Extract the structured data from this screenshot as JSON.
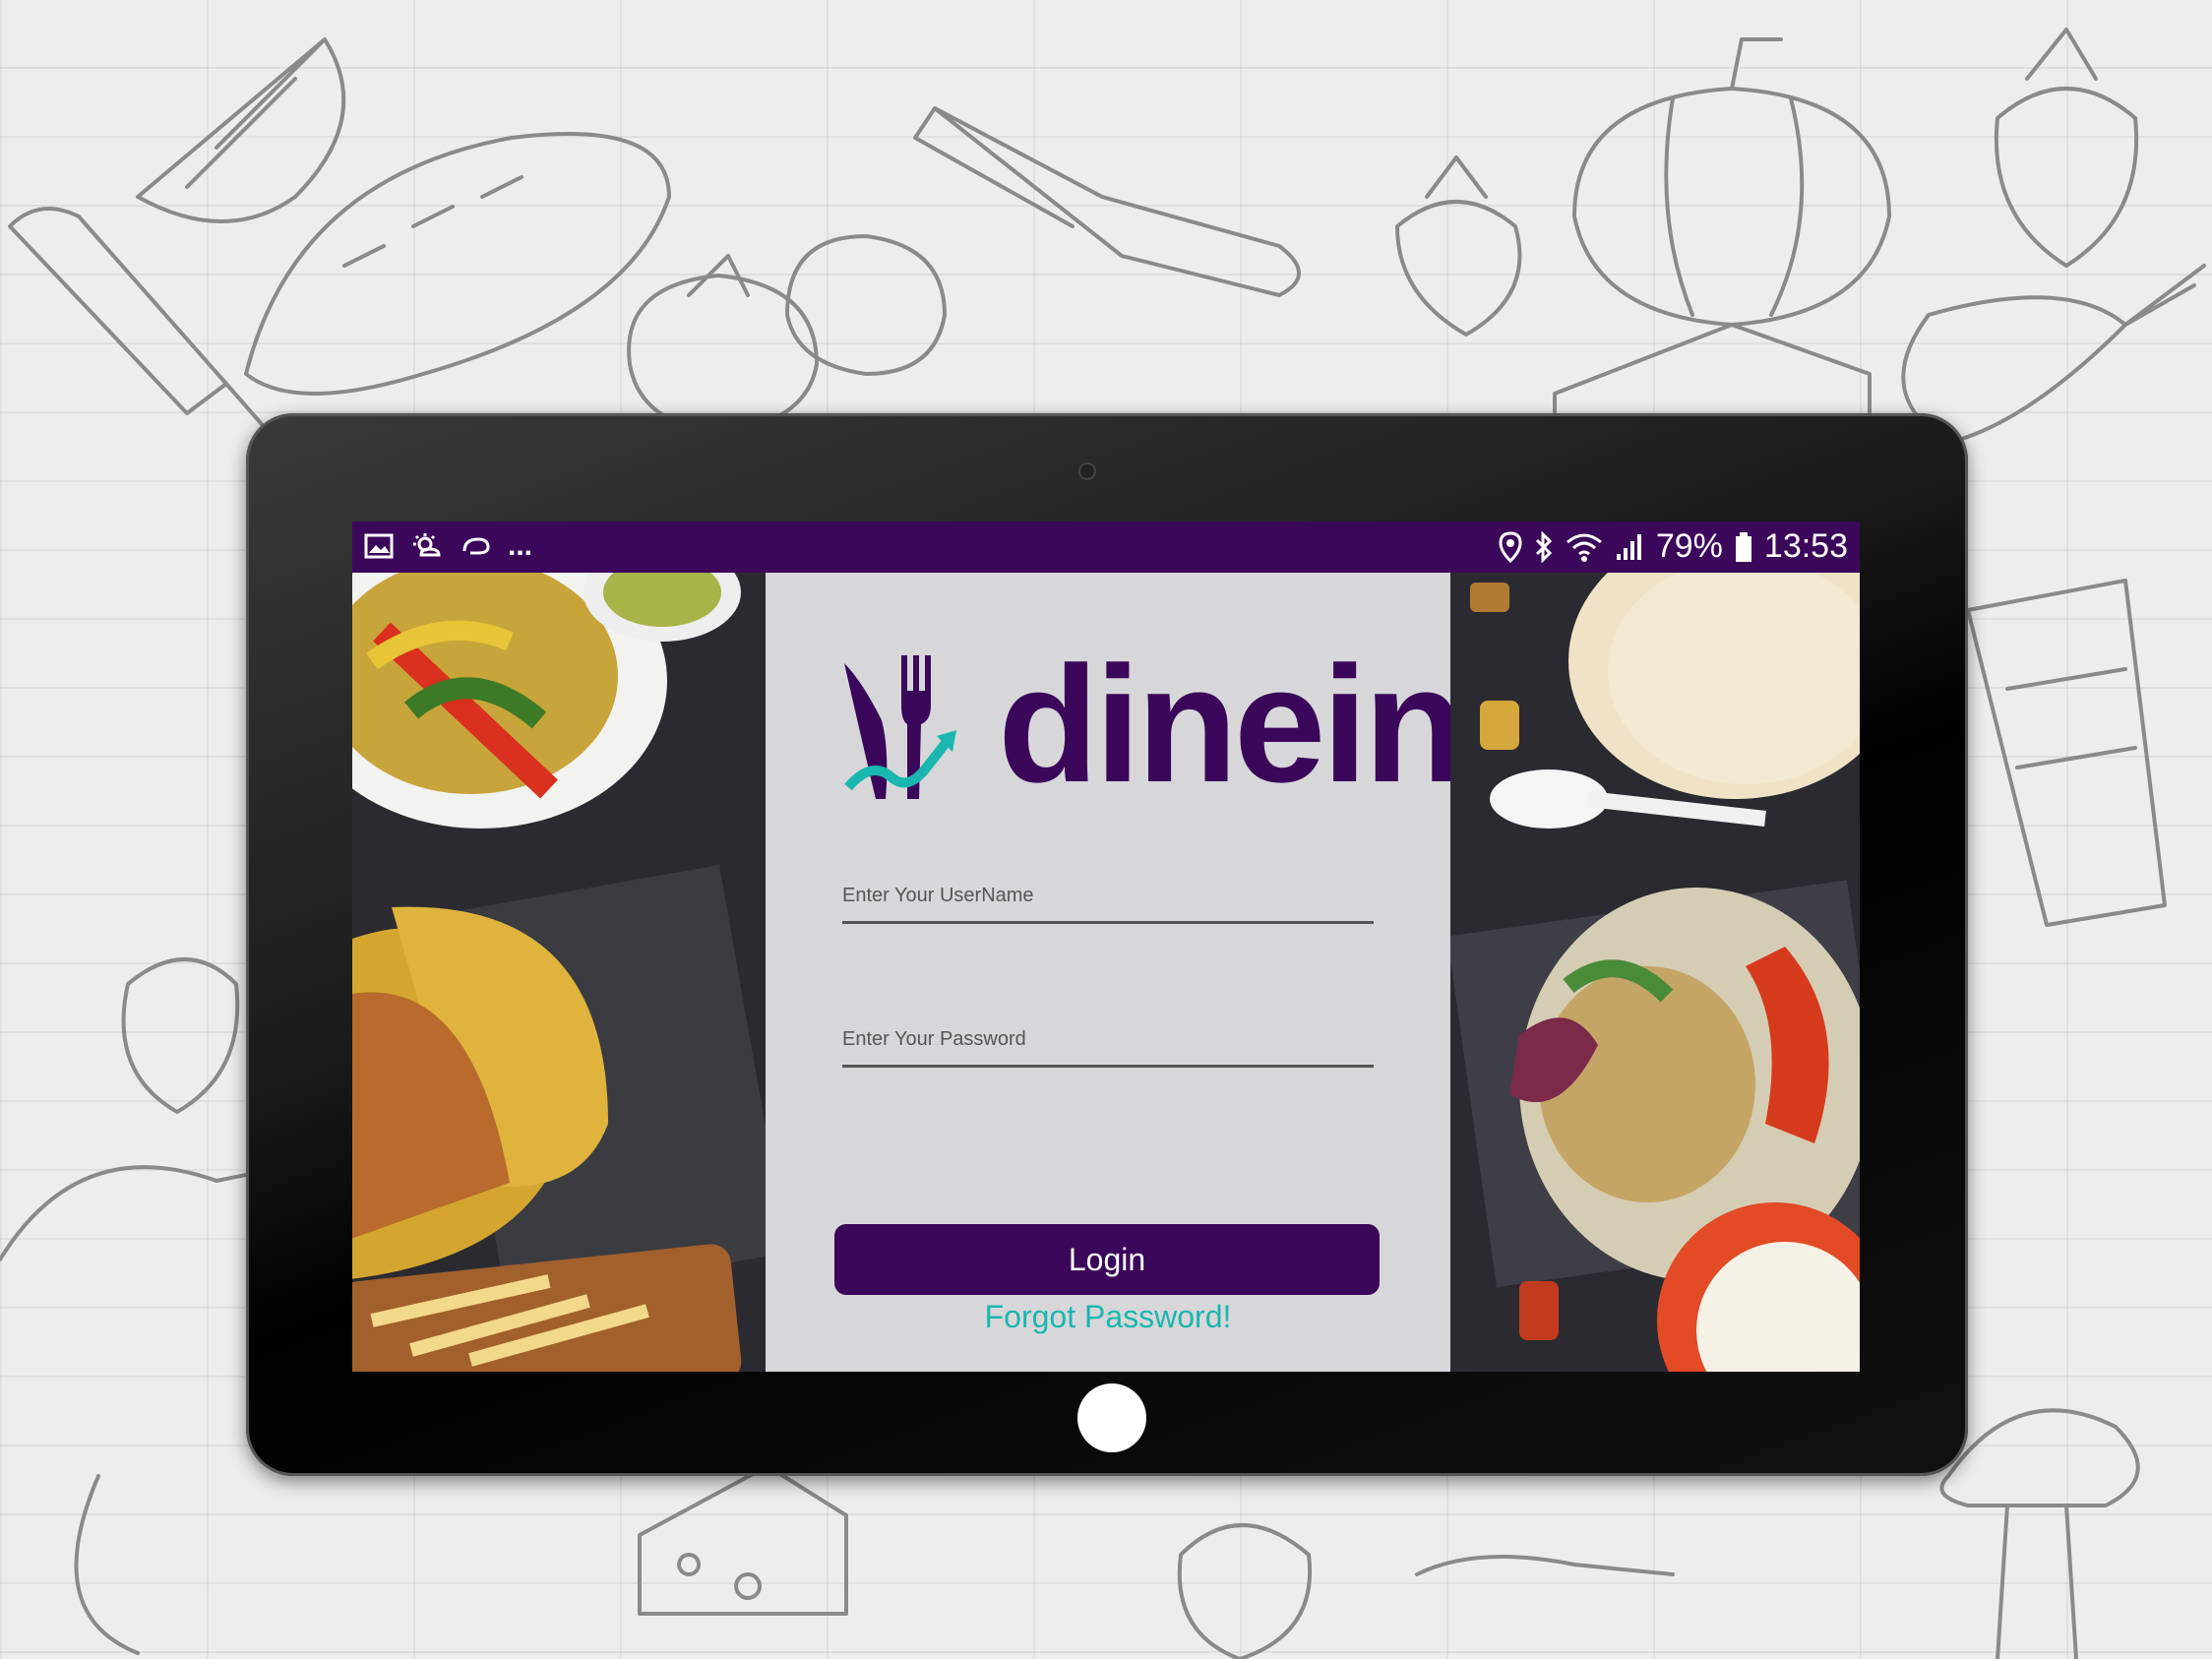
{
  "status_bar": {
    "battery_percent": "79%",
    "time": "13:53",
    "overflow": "...",
    "background_color": "#3b075a",
    "icons_left": [
      "image-icon",
      "weather-icon",
      "sync-icon"
    ],
    "icons_right": [
      "location-icon",
      "bluetooth-icon",
      "wifi-icon",
      "signal-icon",
      "battery-icon"
    ]
  },
  "app": {
    "logo_text": "dinein",
    "brand_color": "#3b075a",
    "accent_color": "#1bb6b0"
  },
  "login_form": {
    "username_placeholder": "Enter Your UserName",
    "username_value": "",
    "password_placeholder": "Enter Your Password",
    "password_value": "",
    "login_label": "Login",
    "forgot_label": "Forgot Password!"
  }
}
